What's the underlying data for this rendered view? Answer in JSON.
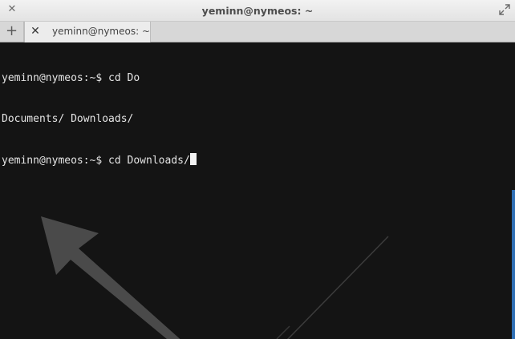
{
  "window": {
    "title": "yeminn@nymeos: ~",
    "close_icon": "close-icon",
    "maximize_icon": "maximize-icon"
  },
  "tabs": {
    "new_tab_glyph": "+",
    "items": [
      {
        "label": "yeminn@nymeos: ~",
        "close_glyph": "✕",
        "active": true
      }
    ]
  },
  "terminal": {
    "lines": [
      {
        "text": "yeminn@nymeos:~$ cd Do"
      },
      {
        "text": "Documents/ Downloads/"
      },
      {
        "text": "yeminn@nymeos:~$ cd Downloads/"
      }
    ],
    "cursor_visible": true
  },
  "colors": {
    "terminal_bg": "#141414",
    "terminal_fg": "#e4e4e4",
    "scrollbar": "#2f6fb5"
  }
}
